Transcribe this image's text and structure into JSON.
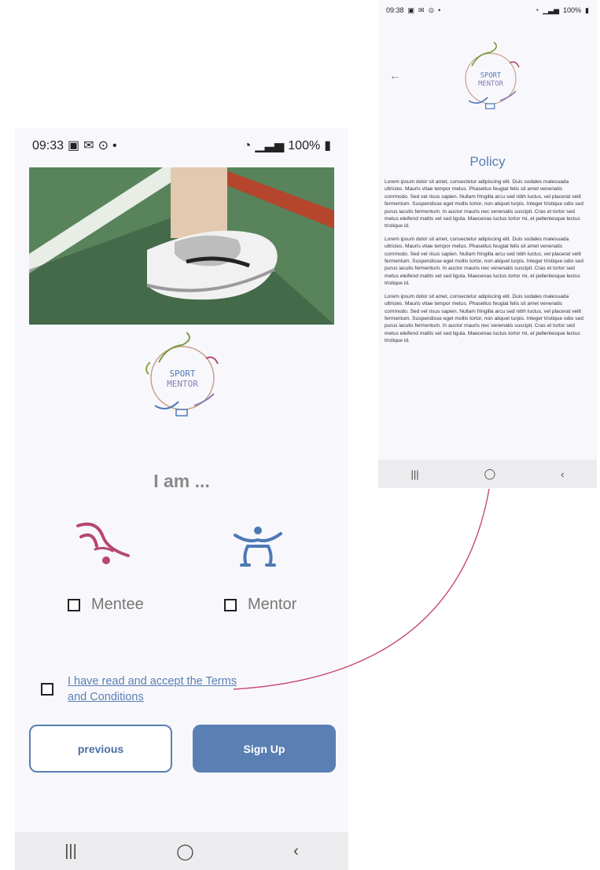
{
  "left_screen": {
    "status": {
      "time": "09:33",
      "battery": "100%"
    },
    "heading": "I am ...",
    "roles": [
      {
        "label": "Mentee"
      },
      {
        "label": "Mentor"
      }
    ],
    "terms_text": "I have read and accept the Terms and Conditions",
    "buttons": {
      "previous": "previous",
      "signup": "Sign Up"
    },
    "logo": {
      "line1": "SPORT",
      "line2": "MENTOR"
    },
    "nav": {
      "recent": "|||",
      "home": "◯",
      "back": "‹"
    }
  },
  "right_screen": {
    "status": {
      "time": "09:38",
      "battery": "100%"
    },
    "title": "Policy",
    "paragraphs": [
      "Lorem ipsum dolor sit amet, consectetur adipiscing elit. Duis sodales malesuada ultricies. Mauris vitae tempor metus. Phasellus feugiat felis sit amet venenatis commodo. Sed vel risus sapien. Nullam fringilla arcu sed nibh luctus, vel placerat velit fermentum. Suspendisse eget mollis tortor, non aliquet turpis. Integer tristique odio sed purus iaculis fermentum. In auctor mauris nec venenatis suscipit. Cras et tortor sed metus eleifend mattis vel sed ligula. Maecenas luctus tortor mi, et pellentesque lectus tristique id.",
      "Lorem ipsum dolor sit amet, consectetur adipiscing elit. Duis sodales malesuada ultricies. Mauris vitae tempor metus. Phasellus feugiat felis sit amet venenatis commodo. Sed vel risus sapien. Nullam fringilla arcu sed nibh luctus, vel placerat velit fermentum. Suspendisse eget mollis tortor, non aliquet turpis. Integer tristique odio sed purus iaculis fermentum. In auctor mauris nec venenatis suscipit. Cras et tortor sed metus eleifend mattis vel sed ligula. Maecenas luctus tortor mi, et pellentesque lectus tristique id.",
      "Lorem ipsum dolor sit amet, consectetur adipiscing elit. Duis sodales malesuada ultricies. Mauris vitae tempor metus. Phasellus feugiat felis sit amet venenatis commodo. Sed vel risus sapien. Nullam fringilla arcu sed nibh luctus, vel placerat velit fermentum. Suspendisse eget mollis tortor, non aliquet turpis. Integer tristique odio sed purus iaculis fermentum. In auctor mauris nec venenatis suscipit. Cras et tortor sed metus eleifend mattis vel sed ligula. Maecenas luctus tortor mi, et pellentesque lectus tristique id."
    ],
    "nav": {
      "recent": "|||",
      "home": "◯",
      "back": "‹"
    },
    "back_icon": "←"
  },
  "colors": {
    "accent": "#5a7fb3",
    "mentee": "#b5486e",
    "mentor": "#4d79b5",
    "connector": "#c84a6e"
  }
}
